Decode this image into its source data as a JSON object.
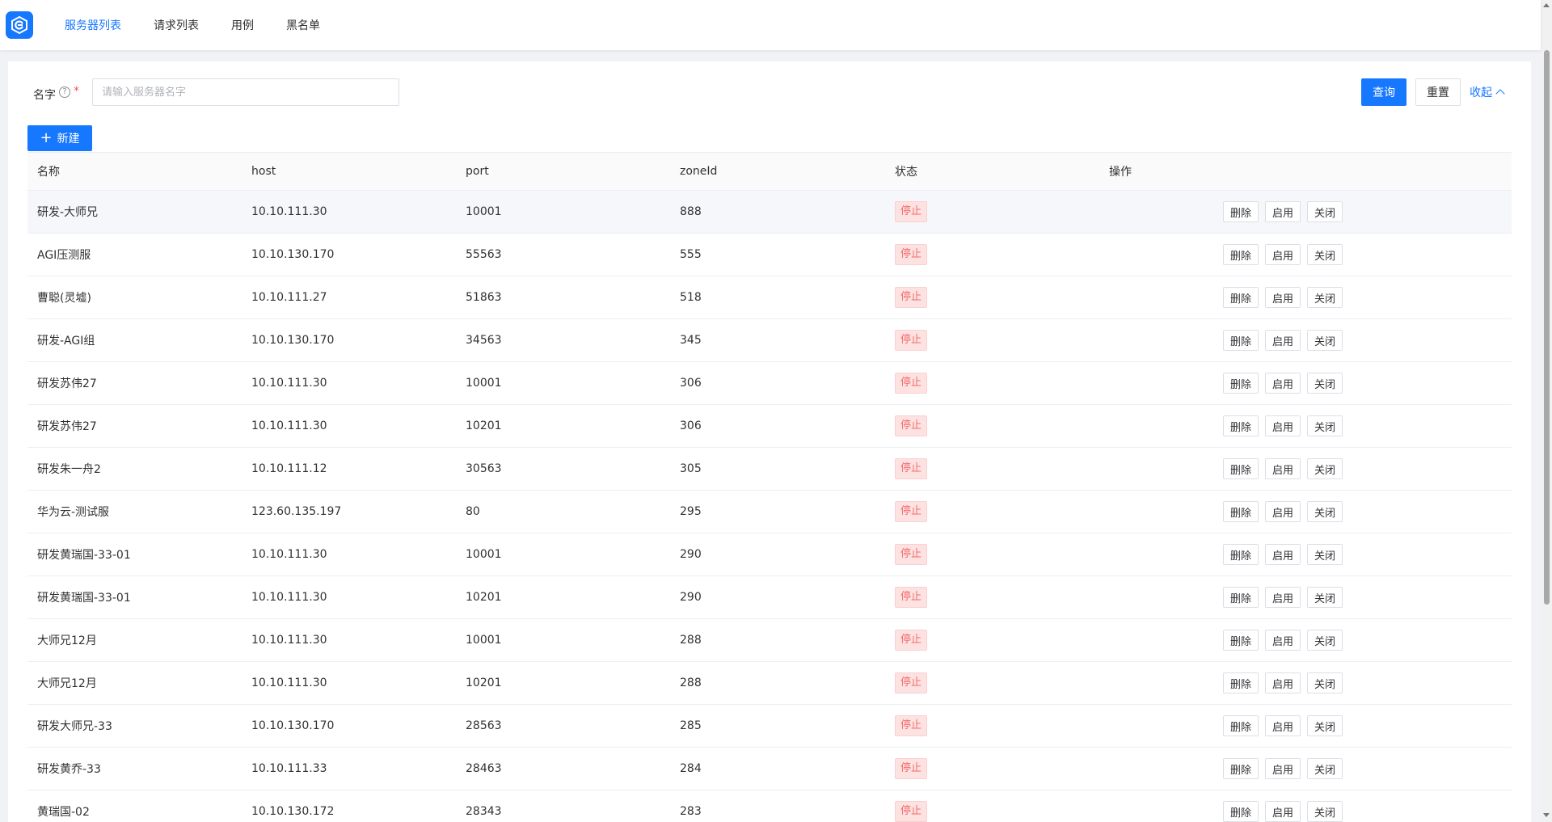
{
  "nav": {
    "items": [
      {
        "label": "服务器列表",
        "active": true
      },
      {
        "label": "请求列表",
        "active": false
      },
      {
        "label": "用例",
        "active": false
      },
      {
        "label": "黑名单",
        "active": false
      }
    ]
  },
  "search": {
    "label": "名字",
    "help_icon": "?",
    "required_mark": "*",
    "placeholder": "请输入服务器名字",
    "value": "",
    "query_label": "查询",
    "reset_label": "重置",
    "collapse_label": "收起"
  },
  "toolbar": {
    "new_label": "新建",
    "new_icon": "+"
  },
  "table": {
    "columns": [
      "名称",
      "host",
      "port",
      "zoneId",
      "状态",
      "操作"
    ],
    "actions": [
      "删除",
      "启用",
      "关闭"
    ],
    "rows": [
      {
        "name": "研发-大师兄",
        "host": "10.10.111.30",
        "port": "10001",
        "zoneId": "888",
        "status": "停止"
      },
      {
        "name": "AGI压测服",
        "host": "10.10.130.170",
        "port": "55563",
        "zoneId": "555",
        "status": "停止"
      },
      {
        "name": "曹聪(灵墟)",
        "host": "10.10.111.27",
        "port": "51863",
        "zoneId": "518",
        "status": "停止"
      },
      {
        "name": "研发-AGI组",
        "host": "10.10.130.170",
        "port": "34563",
        "zoneId": "345",
        "status": "停止"
      },
      {
        "name": "研发苏伟27",
        "host": "10.10.111.30",
        "port": "10001",
        "zoneId": "306",
        "status": "停止"
      },
      {
        "name": "研发苏伟27",
        "host": "10.10.111.30",
        "port": "10201",
        "zoneId": "306",
        "status": "停止"
      },
      {
        "name": "研发朱一舟2",
        "host": "10.10.111.12",
        "port": "30563",
        "zoneId": "305",
        "status": "停止"
      },
      {
        "name": "华为云-测试服",
        "host": "123.60.135.197",
        "port": "80",
        "zoneId": "295",
        "status": "停止"
      },
      {
        "name": "研发黄瑞国-33-01",
        "host": "10.10.111.30",
        "port": "10001",
        "zoneId": "290",
        "status": "停止"
      },
      {
        "name": "研发黄瑞国-33-01",
        "host": "10.10.111.30",
        "port": "10201",
        "zoneId": "290",
        "status": "停止"
      },
      {
        "name": "大师兄12月",
        "host": "10.10.111.30",
        "port": "10001",
        "zoneId": "288",
        "status": "停止"
      },
      {
        "name": "大师兄12月",
        "host": "10.10.111.30",
        "port": "10201",
        "zoneId": "288",
        "status": "停止"
      },
      {
        "name": "研发大师兄-33",
        "host": "10.10.130.170",
        "port": "28563",
        "zoneId": "285",
        "status": "停止"
      },
      {
        "name": "研发黄乔-33",
        "host": "10.10.111.33",
        "port": "28463",
        "zoneId": "284",
        "status": "停止"
      },
      {
        "name": "黄瑞国-02",
        "host": "10.10.130.172",
        "port": "28343",
        "zoneId": "283",
        "status": "停止"
      }
    ]
  },
  "colors": {
    "primary": "#1677ff",
    "danger_text": "#f56c6c",
    "danger_bg": "#fde2e2"
  },
  "icons": {
    "logo": "app-logo-icon",
    "help": "question-circle-icon",
    "collapse": "chevron-up-icon",
    "new": "plus-icon"
  }
}
